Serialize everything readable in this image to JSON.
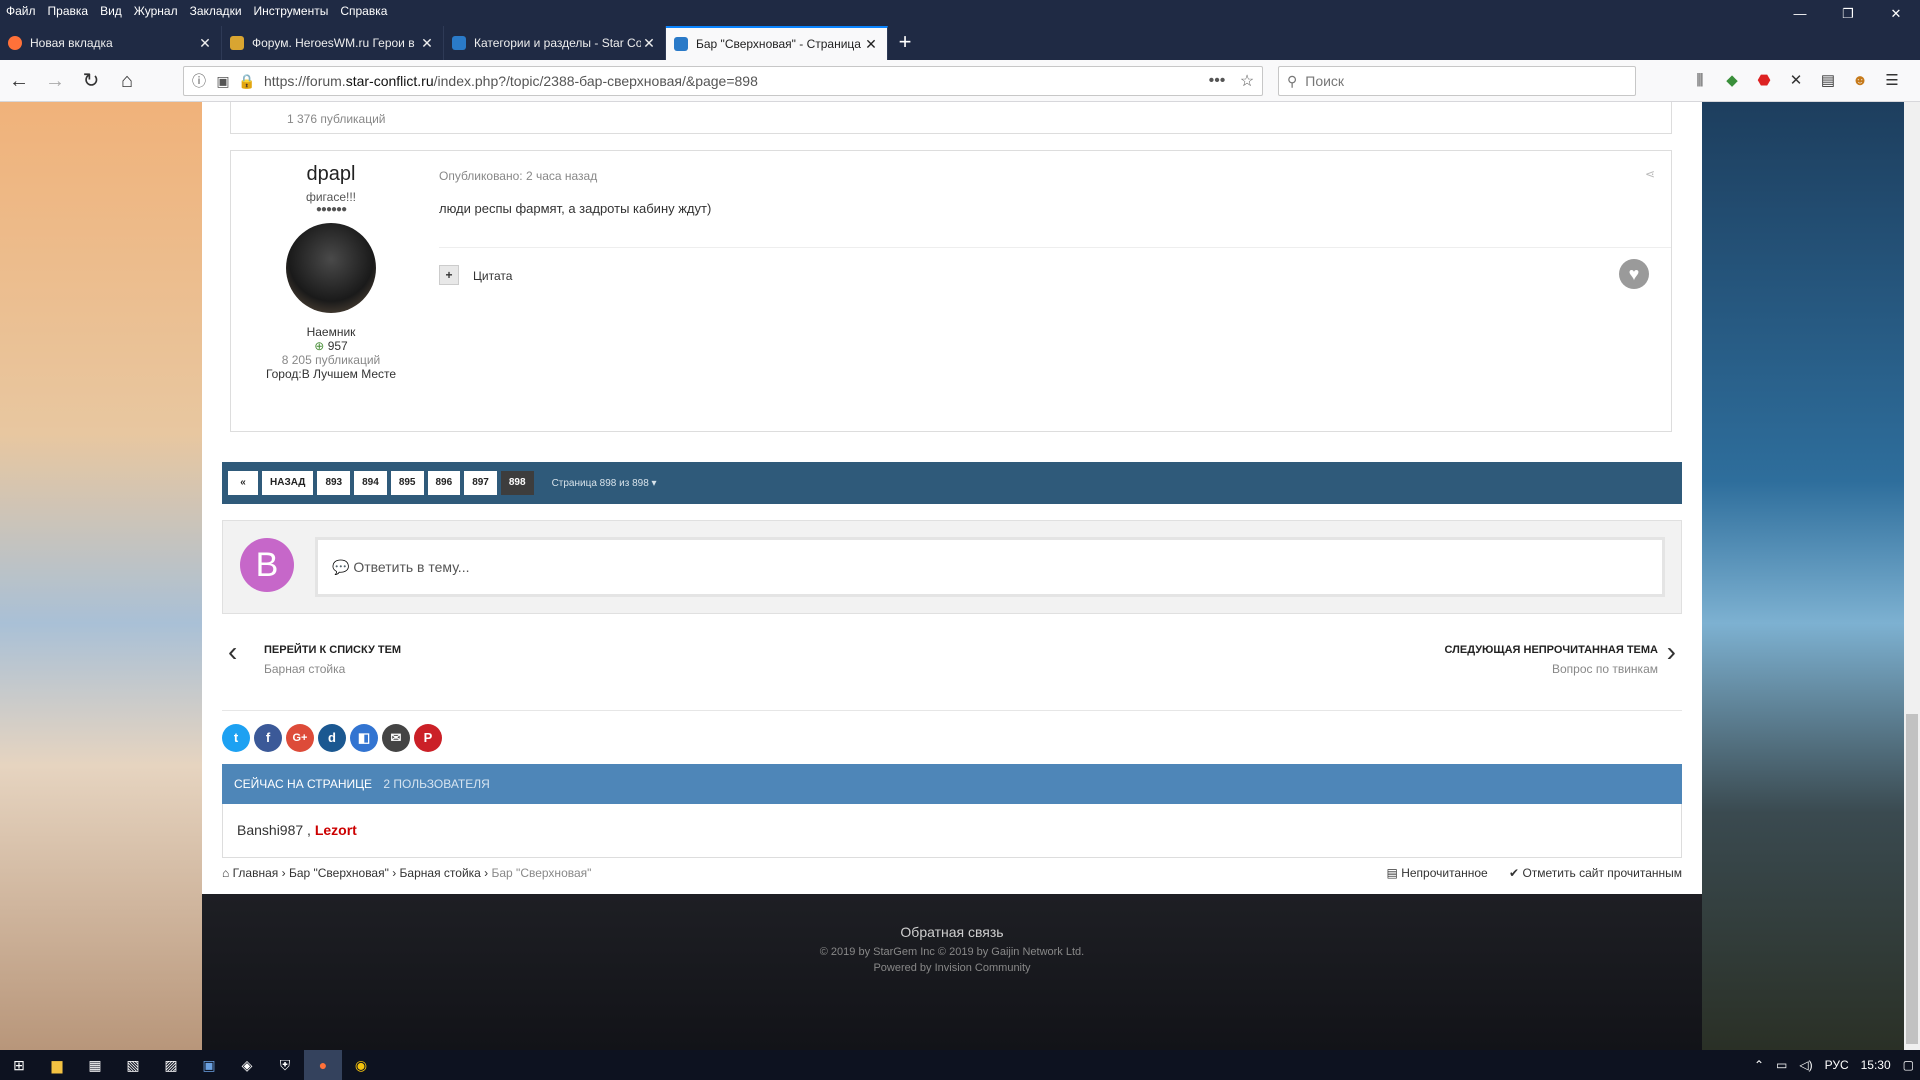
{
  "menubar": [
    "Файл",
    "Правка",
    "Вид",
    "Журнал",
    "Закладки",
    "Инструменты",
    "Справка"
  ],
  "window_controls": {
    "minimize": "—",
    "restore": "❐",
    "close": "✕"
  },
  "tabs": [
    {
      "title": "Новая вкладка",
      "color": "#ff7139"
    },
    {
      "title": "Форум. HeroesWM.ru Герои в",
      "color": "#d9a531"
    },
    {
      "title": "Категории и разделы - Star Co",
      "color": "#2a7ac8"
    },
    {
      "title": "Бар \"Сверхновая\" - Страница",
      "color": "#2a7ac8"
    }
  ],
  "url": {
    "prefix": "https://forum.",
    "domain": "star-conflict.ru",
    "path": "/index.php?/topic/2388-бар-сверхновая/&page=898",
    "more": "•••"
  },
  "search": {
    "placeholder": "Поиск"
  },
  "prev_post": {
    "posts": "1 376 публикаций"
  },
  "post": {
    "author": "dpapl",
    "title": "фигасе!!!",
    "pips": "●●●●●●",
    "rank": "Наемник",
    "rep": "957",
    "posts": "8 205 публикаций",
    "city": "Город:В Лучшем Месте",
    "published": "Опубликовано: 2 часа назад",
    "text": "люди респы фармят, а задроты кабину ждут)",
    "quote": "Цитата",
    "plus": "+",
    "heart": "♥"
  },
  "pagination": {
    "prev_first": "«",
    "back": "НАЗАД",
    "pages": [
      "893",
      "894",
      "895",
      "896",
      "897",
      "898"
    ],
    "current": "898",
    "label": "Страница 898 из 898 ▾"
  },
  "reply": {
    "avatar_letter": "B",
    "placeholder": "💬 Ответить в тему..."
  },
  "topic_nav": {
    "left_title": "ПЕРЕЙТИ К СПИСКУ ТЕМ",
    "left_sub": "Барная стойка",
    "right_title": "СЛЕДУЮЩАЯ НЕПРОЧИТАННАЯ ТЕМА",
    "right_sub": "Вопрос по твинкам"
  },
  "share_buttons": [
    {
      "name": "twitter",
      "glyph": "t",
      "color": "#1da1f2"
    },
    {
      "name": "facebook",
      "glyph": "f",
      "color": "#3b5998"
    },
    {
      "name": "google-plus",
      "glyph": "G+",
      "color": "#dd4b39"
    },
    {
      "name": "digg",
      "glyph": "d",
      "color": "#1b5891"
    },
    {
      "name": "delicious",
      "glyph": "◧",
      "color": "#3274d1"
    },
    {
      "name": "email",
      "glyph": "✉",
      "color": "#444444"
    },
    {
      "name": "pinterest",
      "glyph": "P",
      "color": "#cb2027"
    }
  ],
  "online": {
    "heading": "СЕЙЧАС НА СТРАНИЦЕ",
    "count": "2 ПОЛЬЗОВАТЕЛЯ",
    "user1": "Banshi987",
    "sep": " , ",
    "user2": "Lezort",
    "user2_color": "#cc0000"
  },
  "breadcrumbs": [
    "Главная",
    "Бар \"Сверхновая\"",
    "Барная стойка",
    "Бар \"Сверхновая\""
  ],
  "breadcrumb_right": {
    "unread": "Непрочитанное",
    "mark_read": "Отметить сайт прочитанным"
  },
  "footer": {
    "feedback": "Обратная связь",
    "copyright": "© 2019 by StarGem Inc © 2019 by Gaijin Network Ltd.",
    "powered": "Powered by Invision Community"
  },
  "taskbar": {
    "time": "15:30",
    "lang": "РУС"
  }
}
